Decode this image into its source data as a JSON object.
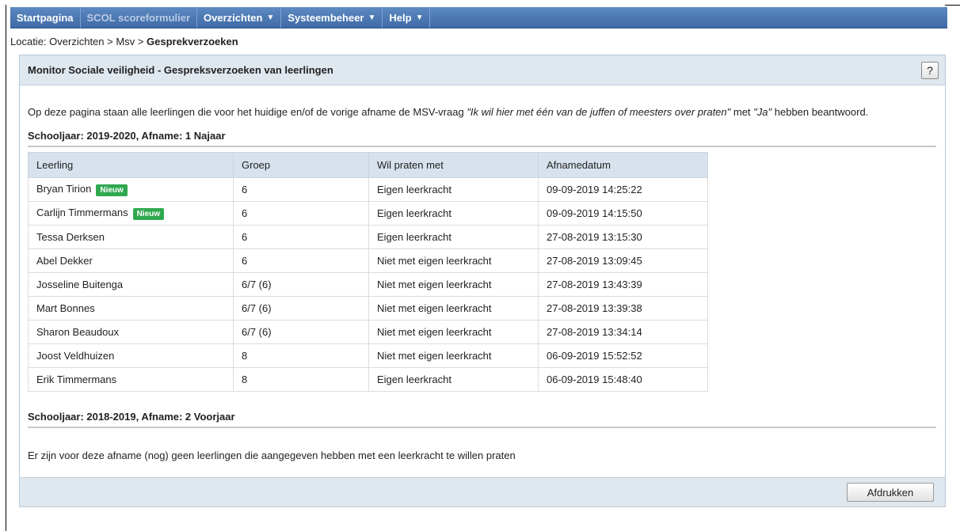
{
  "nav": {
    "items": [
      {
        "label": "Startpagina",
        "arrow": ""
      },
      {
        "label": "SCOL scoreformulier",
        "arrow": ""
      },
      {
        "label": "Overzichten",
        "arrow": "▼"
      },
      {
        "label": "Systeembeheer",
        "arrow": "▼"
      },
      {
        "label": "Help",
        "arrow": "▼"
      }
    ]
  },
  "breadcrumb": {
    "prefix": "Locatie: ",
    "items": [
      "Overzichten",
      "Msv"
    ],
    "separator": " > ",
    "current": "Gesprekverzoeken"
  },
  "panel": {
    "title": "Monitor Sociale veiligheid - Gespreksverzoeken van leerlingen",
    "help_label": "?",
    "intro_part1": "Op deze pagina staan alle leerlingen die voor het huidige en/of de vorige afname de MSV-vraag ",
    "intro_quote": "\"Ik wil hier met één van de juffen of meesters over praten\"",
    "intro_part2": " met ",
    "intro_answer": "\"Ja\"",
    "intro_part3": " hebben beantwoord."
  },
  "section1": {
    "title": "Schooljaar: 2019-2020, Afname: 1 Najaar",
    "columns": [
      "Leerling",
      "Groep",
      "Wil praten met",
      "Afnamedatum"
    ],
    "badge_label": "Nieuw",
    "rows": [
      {
        "name": "Bryan Tirion",
        "new": true,
        "groep": "6",
        "praten": "Eigen leerkracht",
        "datum": "09-09-2019 14:25:22"
      },
      {
        "name": "Carlijn Timmermans",
        "new": true,
        "groep": "6",
        "praten": "Eigen leerkracht",
        "datum": "09-09-2019 14:15:50"
      },
      {
        "name": "Tessa Derksen",
        "new": false,
        "groep": "6",
        "praten": "Eigen leerkracht",
        "datum": "27-08-2019 13:15:30"
      },
      {
        "name": "Abel Dekker",
        "new": false,
        "groep": "6",
        "praten": "Niet met eigen leerkracht",
        "datum": "27-08-2019 13:09:45"
      },
      {
        "name": "Josseline Buitenga",
        "new": false,
        "groep": "6/7 (6)",
        "praten": "Niet met eigen leerkracht",
        "datum": "27-08-2019 13:43:39"
      },
      {
        "name": "Mart Bonnes",
        "new": false,
        "groep": "6/7 (6)",
        "praten": "Niet met eigen leerkracht",
        "datum": "27-08-2019 13:39:38"
      },
      {
        "name": "Sharon Beaudoux",
        "new": false,
        "groep": "6/7 (6)",
        "praten": "Niet met eigen leerkracht",
        "datum": "27-08-2019 13:34:14"
      },
      {
        "name": "Joost Veldhuizen",
        "new": false,
        "groep": "8",
        "praten": "Niet met eigen leerkracht",
        "datum": "06-09-2019 15:52:52"
      },
      {
        "name": "Erik Timmermans",
        "new": false,
        "groep": "8",
        "praten": "Eigen leerkracht",
        "datum": "06-09-2019 15:48:40"
      }
    ]
  },
  "section2": {
    "title": "Schooljaar: 2018-2019, Afname: 2 Voorjaar",
    "empty_message": "Er zijn voor deze afname (nog) geen leerlingen die aangegeven hebben met een leerkracht te willen praten"
  },
  "footer": {
    "print_label": "Afdrukken"
  }
}
